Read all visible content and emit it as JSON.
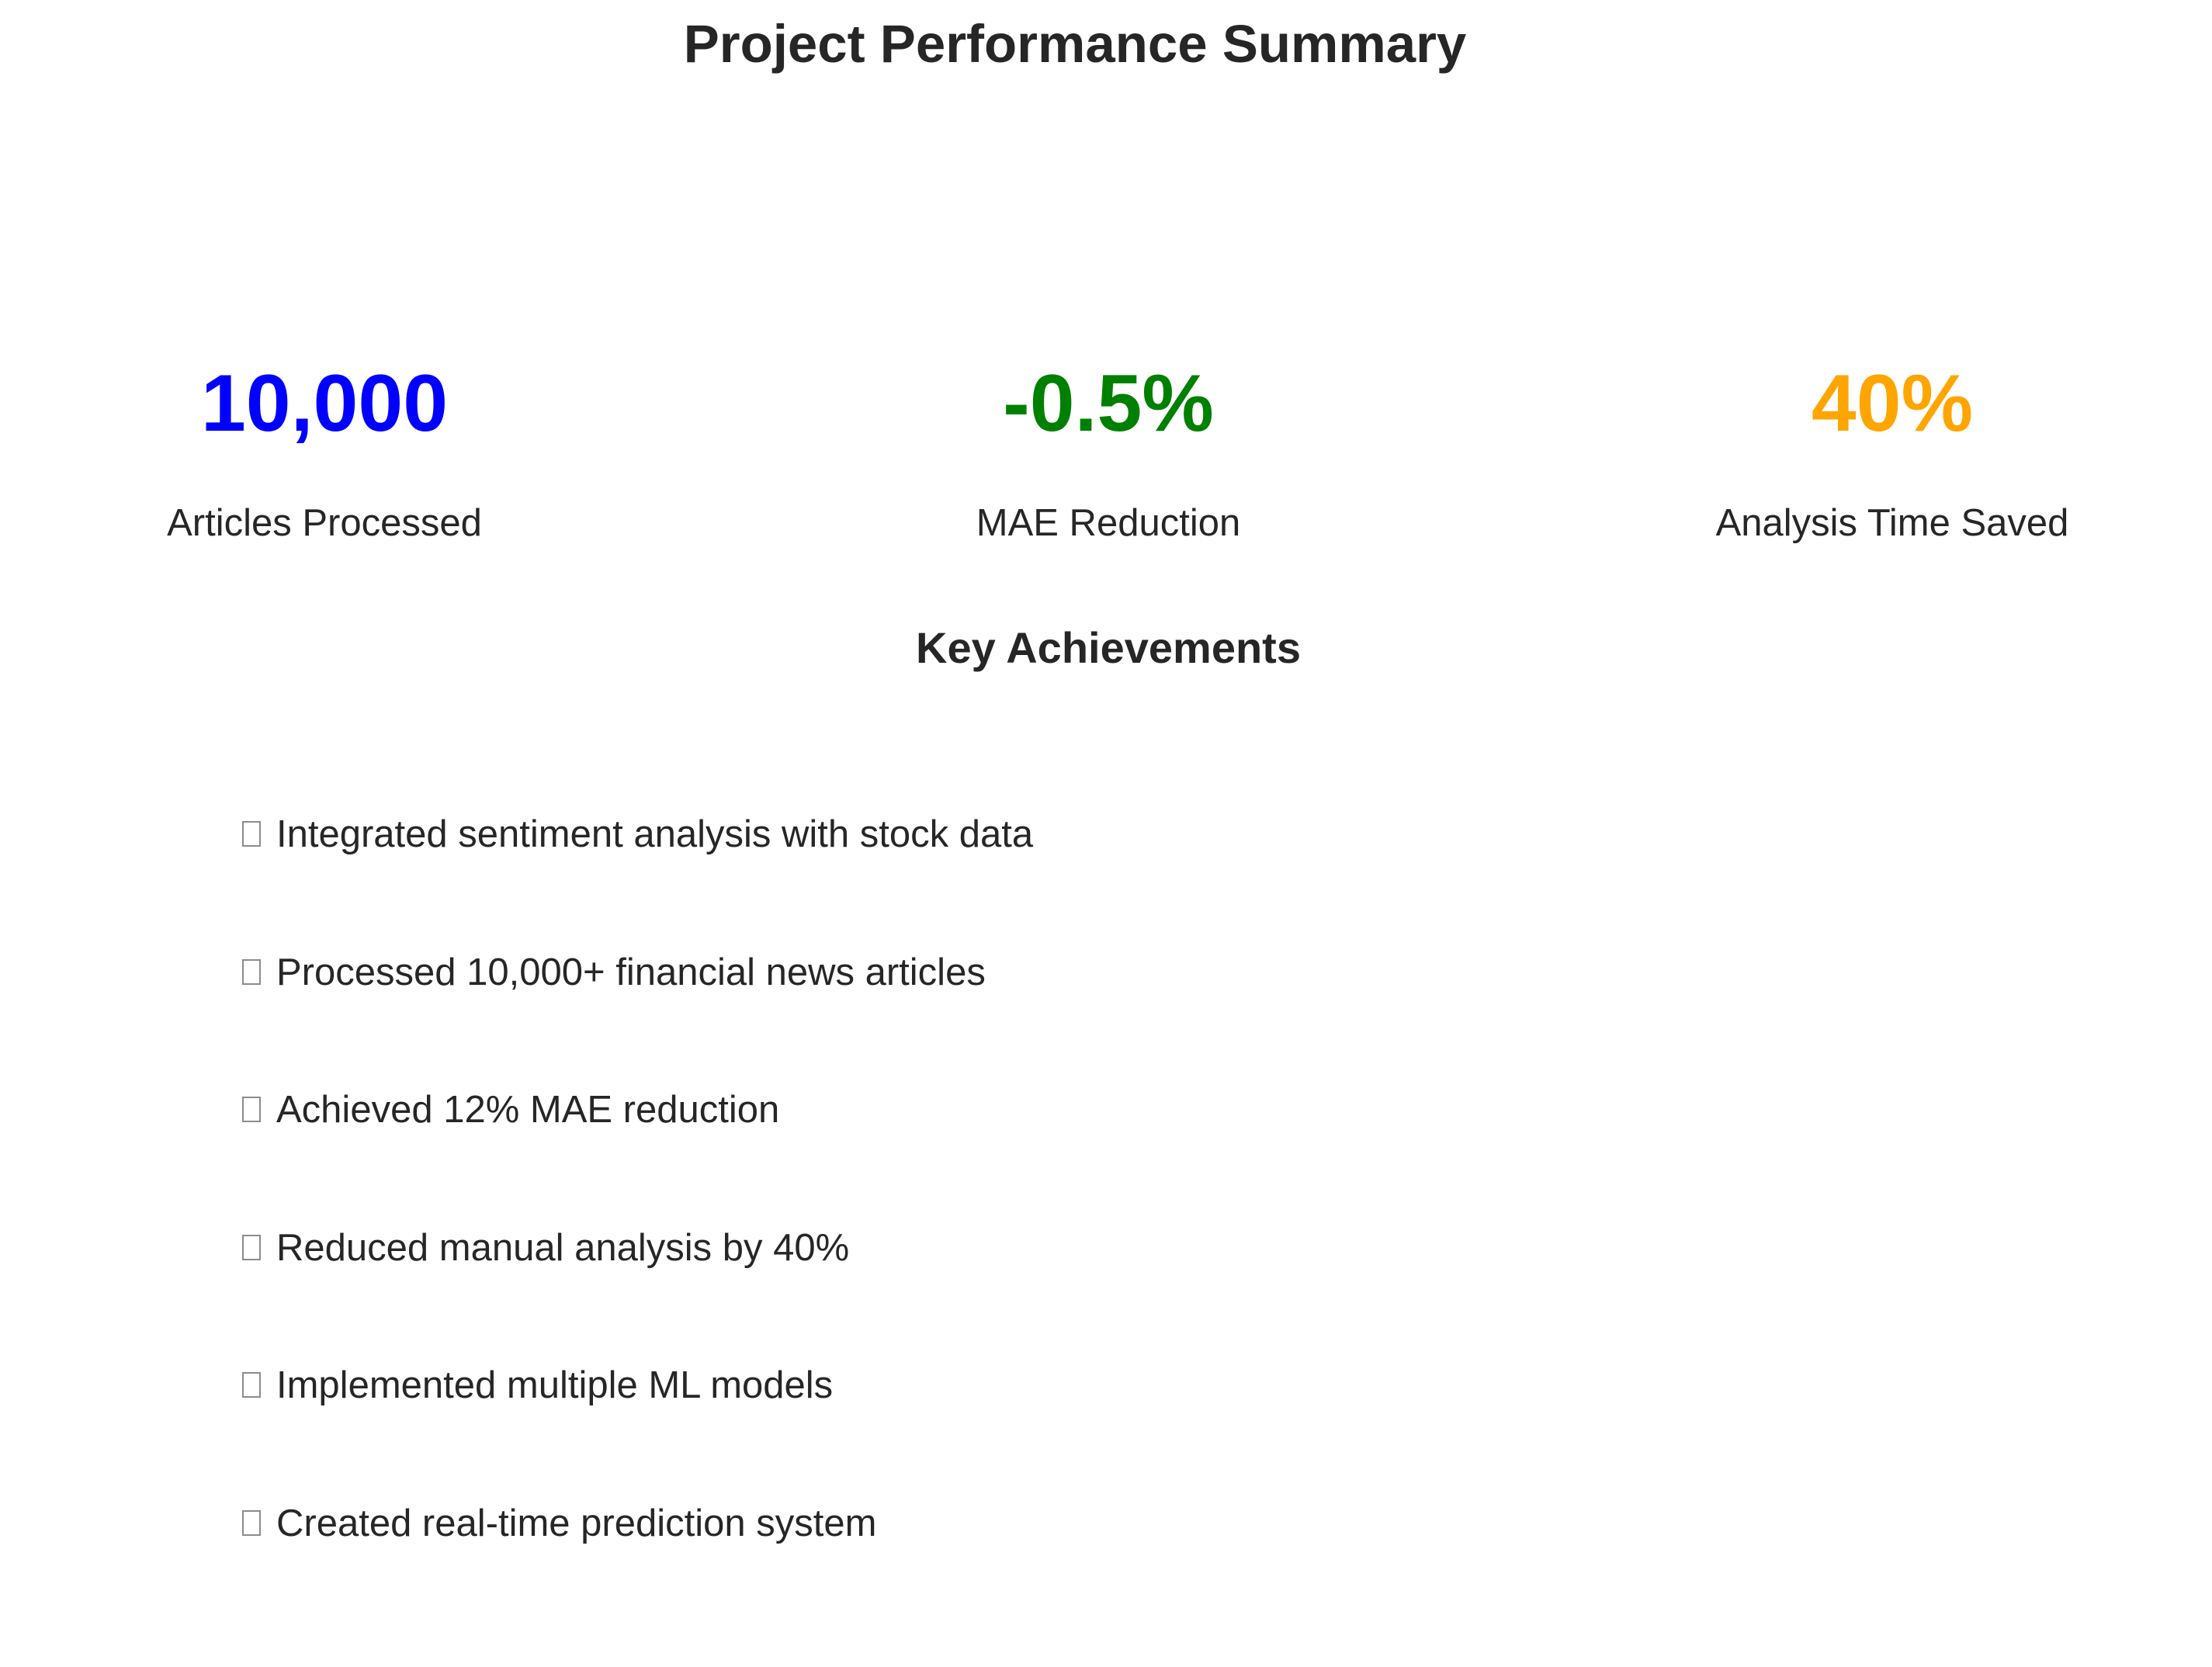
{
  "title": "Project Performance Summary",
  "metrics": [
    {
      "value": "10,000",
      "label": "Articles Processed",
      "color": "#0000ff"
    },
    {
      "value": "-0.5%",
      "label": "MAE Reduction",
      "color": "#008000"
    },
    {
      "value": "40%",
      "label": "Analysis Time Saved",
      "color": "#ffa500"
    }
  ],
  "achievements_title": "Key Achievements",
  "achievements": [
    {
      "icon": "missing-glyph-box-icon",
      "text": "Integrated sentiment analysis with stock data"
    },
    {
      "icon": "missing-glyph-box-icon",
      "text": "Processed 10,000+ financial news articles"
    },
    {
      "icon": "missing-glyph-box-icon",
      "text": "Achieved 12% MAE reduction"
    },
    {
      "icon": "missing-glyph-box-icon",
      "text": "Reduced manual analysis by 40%"
    },
    {
      "icon": "missing-glyph-box-icon",
      "text": "Implemented multiple ML models"
    },
    {
      "icon": "missing-glyph-box-icon",
      "text": "Created real-time prediction system"
    }
  ]
}
